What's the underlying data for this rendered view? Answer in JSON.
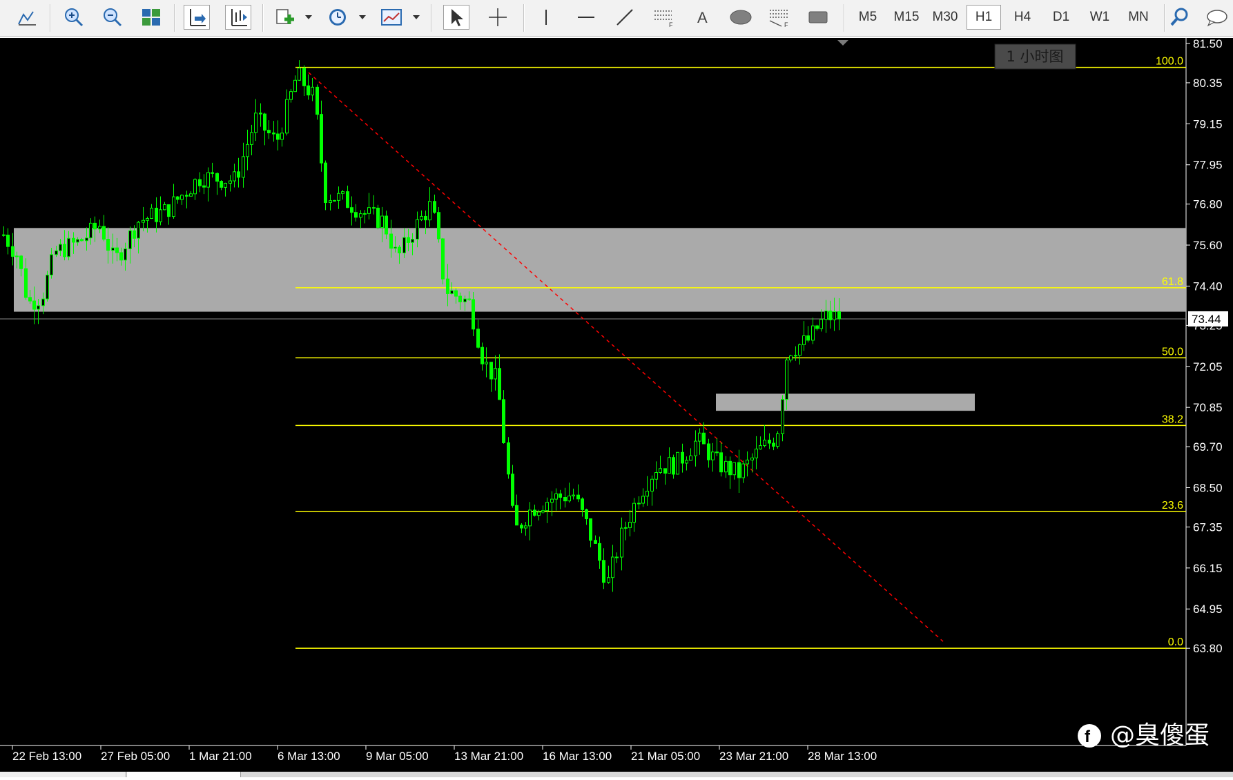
{
  "toolbar": {
    "tools": [
      {
        "icon": "new-chart-icon"
      },
      {
        "icon": "zoom-in-icon"
      },
      {
        "icon": "zoom-out-icon"
      },
      {
        "icon": "tile-windows-icon"
      },
      {
        "icon": "chart-shift-icon"
      },
      {
        "icon": "auto-scroll-icon"
      },
      {
        "icon": "indicators-icon"
      },
      {
        "icon": "periodicity-icon"
      },
      {
        "icon": "templates-icon"
      },
      {
        "icon": "cursor-icon"
      },
      {
        "icon": "crosshair-icon"
      },
      {
        "icon": "vertical-line-icon"
      },
      {
        "icon": "horizontal-line-icon"
      },
      {
        "icon": "trendline-icon"
      },
      {
        "icon": "equidistant-channel-icon"
      },
      {
        "icon": "text-icon",
        "label": "A"
      },
      {
        "icon": "ellipse-icon"
      },
      {
        "icon": "fibonacci-icon"
      },
      {
        "icon": "rectangle-icon"
      }
    ],
    "timeframes": [
      "M5",
      "M15",
      "M30",
      "H1",
      "H4",
      "D1",
      "W1",
      "MN"
    ],
    "active_timeframe": "H1"
  },
  "chart_label": "1 小时图",
  "watermark": "@臭傻蛋",
  "current_price": "73.44",
  "colors": {
    "background": "#000000",
    "candle": "#00ff00",
    "fib": "#ffff00",
    "zone": "#aaaaaa",
    "trend": "#ff0000",
    "axis_text": "#ffffff"
  },
  "chart_data": {
    "type": "candlestick",
    "y_axis_labels": [
      "81.50",
      "80.35",
      "79.15",
      "77.95",
      "76.80",
      "75.60",
      "74.40",
      "73.25",
      "72.05",
      "70.85",
      "69.70",
      "68.50",
      "67.35",
      "66.15",
      "64.95",
      "63.80"
    ],
    "ylim": [
      63.8,
      81.5
    ],
    "x_axis_labels": [
      "22 Feb 13:00",
      "27 Feb 05:00",
      "1 Mar 21:00",
      "6 Mar 13:00",
      "9 Mar 05:00",
      "13 Mar 21:00",
      "16 Mar 13:00",
      "21 Mar 05:00",
      "23 Mar 21:00",
      "28 Mar 13:00"
    ],
    "fibonacci": {
      "levels": [
        {
          "label": "100.0",
          "price": 80.8
        },
        {
          "label": "61.8",
          "price": 74.35
        },
        {
          "label": "50.0",
          "price": 72.3
        },
        {
          "label": "38.2",
          "price": 70.32
        },
        {
          "label": "23.6",
          "price": 67.8
        },
        {
          "label": "0.0",
          "price": 63.8
        }
      ]
    },
    "zones": [
      {
        "name": "resistance-zone",
        "price_top": 76.1,
        "price_bottom": 73.65
      },
      {
        "name": "support-zone",
        "price_top": 71.25,
        "price_bottom": 70.75
      }
    ],
    "current_price": 73.44,
    "trendline": {
      "style": "dashed",
      "from_price": 80.65,
      "to_price": 64.0
    }
  }
}
